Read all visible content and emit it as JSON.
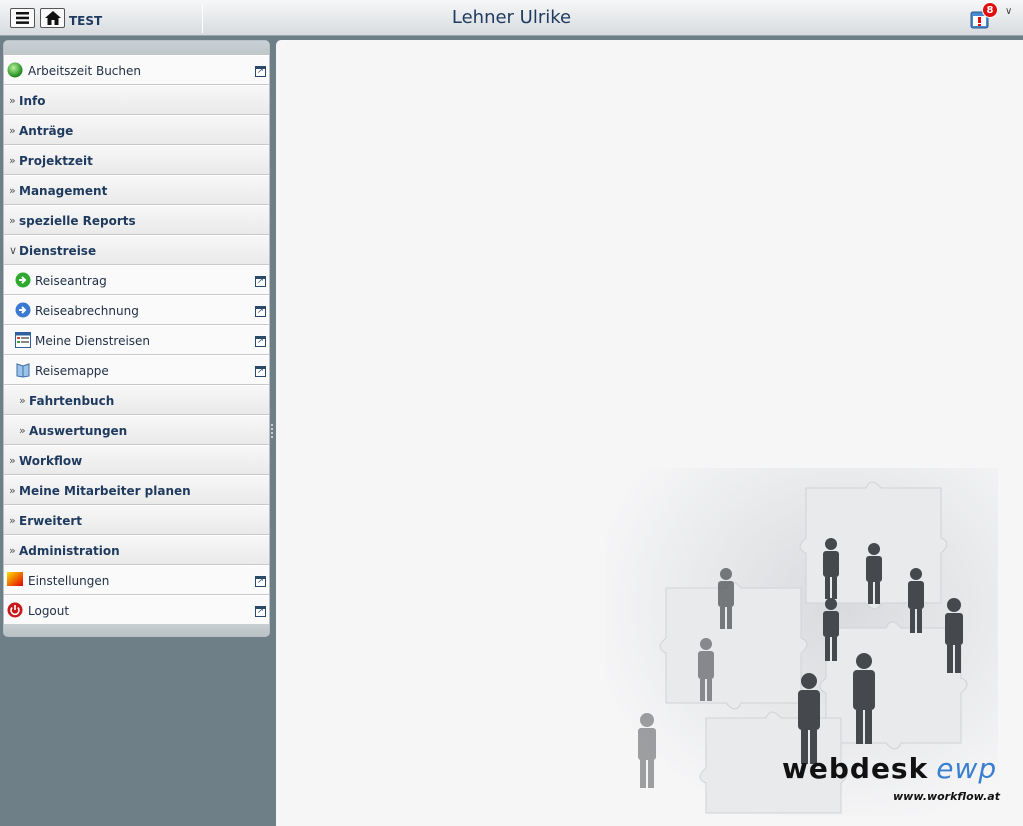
{
  "header": {
    "env_label": "TEST",
    "user_name": "Lehner Ulrike",
    "notification_count": "8",
    "icons": {
      "menu": "hamburger-icon",
      "home": "home-icon",
      "notification": "calendar-alert-icon",
      "expand": "chevron-down-icon"
    }
  },
  "sidebar": {
    "items": [
      {
        "label": "Arbeitszeit Buchen",
        "kind": "link",
        "icon": "green-orb-icon",
        "external": true
      },
      {
        "label": "Info",
        "kind": "group"
      },
      {
        "label": "Anträge",
        "kind": "group"
      },
      {
        "label": "Projektzeit",
        "kind": "group"
      },
      {
        "label": "Management",
        "kind": "group"
      },
      {
        "label": "spezielle Reports",
        "kind": "group"
      },
      {
        "label": "Dienstreise",
        "kind": "group",
        "expanded": true
      },
      {
        "label": "Reiseantrag",
        "kind": "link",
        "icon": "green-arrow-icon",
        "external": true
      },
      {
        "label": "Reiseabrechnung",
        "kind": "link",
        "icon": "blue-arrow-icon",
        "external": true
      },
      {
        "label": "Meine Dienstreisen",
        "kind": "link",
        "icon": "list-window-icon",
        "external": true
      },
      {
        "label": "Reisemappe",
        "kind": "link",
        "icon": "book-icon",
        "external": true
      },
      {
        "label": "Fahrtenbuch",
        "kind": "subgroup"
      },
      {
        "label": "Auswertungen",
        "kind": "subgroup"
      },
      {
        "label": "Workflow",
        "kind": "group"
      },
      {
        "label": "Meine Mitarbeiter planen",
        "kind": "group"
      },
      {
        "label": "Erweitert",
        "kind": "group"
      },
      {
        "label": "Administration",
        "kind": "group"
      },
      {
        "label": "Einstellungen",
        "kind": "link",
        "icon": "gradient-settings-icon",
        "external": true
      },
      {
        "label": "Logout",
        "kind": "link",
        "icon": "power-icon",
        "external": true
      }
    ]
  },
  "content": {
    "brand_name": "webdesk",
    "brand_suffix": "ewp",
    "brand_url": "www.workflow.at"
  },
  "colors": {
    "text_primary": "#1e3a5f",
    "background": "#6f7f88",
    "badge": "#e01010",
    "brand_accent": "#3b7fd0"
  }
}
